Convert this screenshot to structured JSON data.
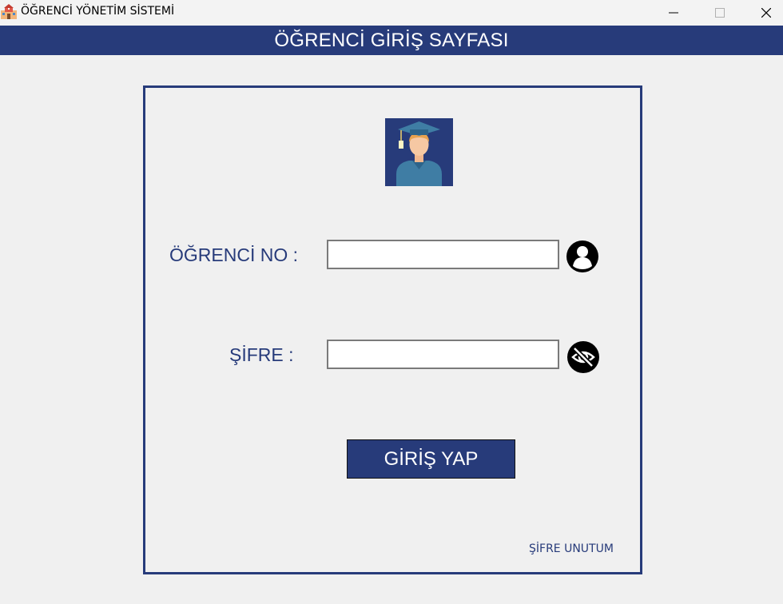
{
  "window": {
    "title": "ÖĞRENCİ YÖNETİM SİSTEMİ",
    "icon": "school-building-icon",
    "controls": [
      "minimize-icon",
      "maximize-icon",
      "close-icon"
    ]
  },
  "header": {
    "title": "ÖĞRENCİ GİRİŞ SAYFASI",
    "background": "#273b7a"
  },
  "form": {
    "avatar_icon": "graduate-student-icon",
    "student_no_label": "ÖĞRENCİ NO :",
    "student_no_value": "",
    "student_no_icon": "user-circle-icon",
    "password_label": "ŞİFRE :",
    "password_value": "",
    "password_icon": "eye-slash-icon",
    "login_button": "GİRİŞ YAP",
    "forgot_password": "ŞİFRE UNUTUM"
  },
  "colors": {
    "accent": "#273b7a",
    "page_background": "#f0f0f0",
    "field_border": "#7a7a7a"
  }
}
